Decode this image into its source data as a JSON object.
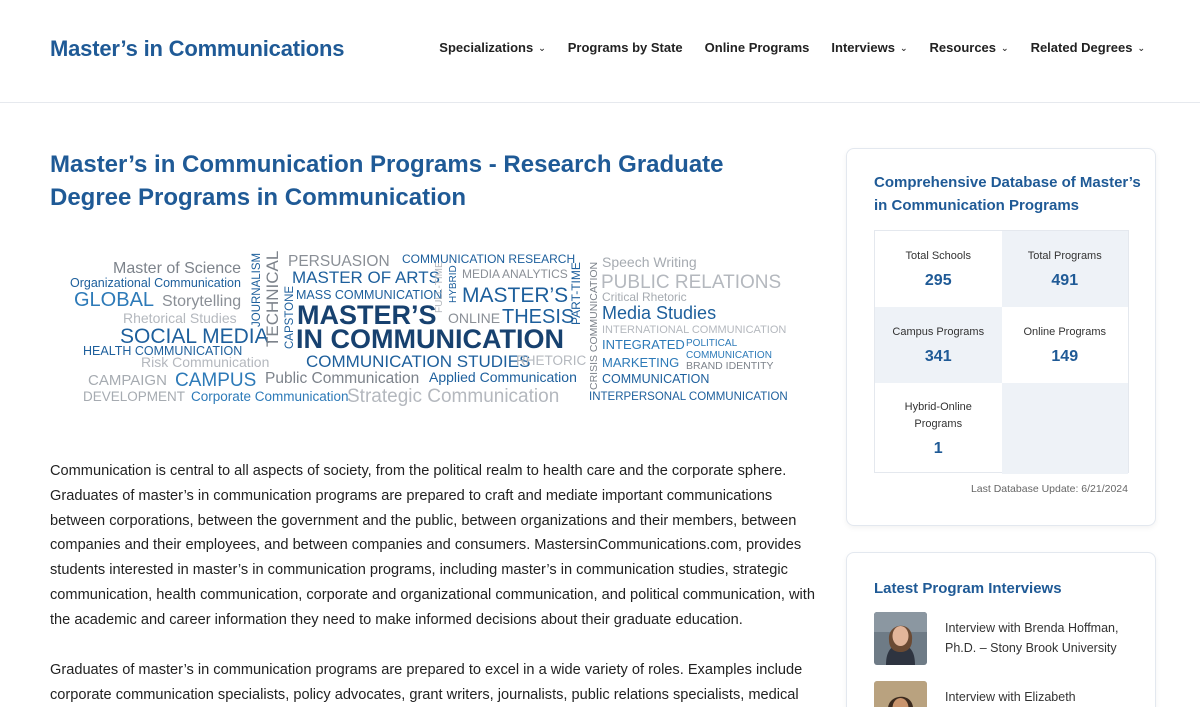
{
  "header": {
    "logo": "Master’s in Communications",
    "nav": [
      {
        "label": "Specializations",
        "has_dropdown": true
      },
      {
        "label": "Programs by State",
        "has_dropdown": false
      },
      {
        "label": "Online Programs",
        "has_dropdown": false
      },
      {
        "label": "Interviews",
        "has_dropdown": true
      },
      {
        "label": "Resources",
        "has_dropdown": true
      },
      {
        "label": "Related Degrees",
        "has_dropdown": true
      }
    ]
  },
  "main": {
    "title": "Master’s in Communication Programs - Research Graduate Degree Programs in Communication",
    "paragraphs": [
      "Communication is central to all aspects of society, from the political realm to health care and the corporate sphere. Graduates of master’s in communication programs are prepared to craft and mediate important communications between corporations, between the government and the public, between organizations and their members, between companies and their employees, and between companies and consumers. MastersinCommunications.com, provides students interested in master’s in communication programs, including master’s in communication studies, strategic communication, health communication, corporate and organizational communication, and political communication, with the academic and career information they need to make informed decisions about their graduate education.",
      "Graduates of master’s in communication programs are prepared to excel in a wide variety of roles. Examples include corporate communication specialists, policy advocates, grant writers, journalists, public relations specialists, medical and"
    ],
    "wordcloud": {
      "words": {
        "master_of_science": "Master of Science",
        "org_comm": "Organizational Communication",
        "global": "GLOBAL",
        "storytelling": "Storytelling",
        "rhetorical": "Rhetorical Studies",
        "social_media": "SOCIAL MEDIA",
        "health_comm": "HEALTH COMMUNICATION",
        "risk_comm": "Risk Communication",
        "campaign": "CAMPAIGN",
        "campus": "CAMPUS",
        "development": "DEVELOPMENT",
        "corporate_comm": "Corporate Communication",
        "journalism": "JOURNALISM",
        "technical": "TECHNICAL",
        "capstone": "CAPSTONE",
        "persuasion": "PERSUASION",
        "master_of_arts": "MASTER OF ARTS",
        "mass_comm": "MASS COMMUNICATION",
        "masters": "MASTER’S",
        "in_communication": "IN COMMUNICATION",
        "full_time": "FULL-TIME",
        "hybrid": "HYBRID",
        "online": "ONLINE",
        "comm_research": "COMMUNICATION RESEARCH",
        "media_analytics": "MEDIA ANALYTICS",
        "masters2": "MASTER’S",
        "thesis": "THESIS",
        "part_time": "PART-TIME",
        "comm_studies": "COMMUNICATION STUDIES",
        "rhetoric": "RHETORIC",
        "public_comm": "Public Communication",
        "applied_comm": "Applied Communication",
        "strategic_comm": "Strategic Communication",
        "crisis_comm": "CRISIS COMMUNICATION",
        "speech_writing": "Speech Writing",
        "public_relations": "PUBLIC RELATIONS",
        "critical_rhetoric": "Critical Rhetoric",
        "media_studies": "Media Studies",
        "intl_comm": "INTERNATIONAL COMMUNICATION",
        "integrated": "INTEGRATED",
        "marketing": "MARKETING",
        "communication": "COMMUNICATION",
        "political": "POLITICAL",
        "political2": "COMMUNICATION",
        "brand_identity": "BRAND IDENTITY",
        "interpersonal": "INTERPERSONAL COMMUNICATION"
      }
    }
  },
  "sidebar": {
    "database": {
      "title": "Comprehensive Database of Master’s in Communication Programs",
      "stats": [
        {
          "label": "Total Schools",
          "value": "295"
        },
        {
          "label": "Total Programs",
          "value": "491"
        },
        {
          "label": "Campus Programs",
          "value": "341"
        },
        {
          "label": "Online Programs",
          "value": "149"
        },
        {
          "label": "Hybrid-Online Programs",
          "value": "1"
        }
      ],
      "last_update": "Last Database Update: 6/21/2024"
    },
    "interviews": {
      "title": "Latest Program Interviews",
      "items": [
        {
          "text": "Interview with Brenda Hoffman, Ph.D. – Stony Brook University"
        },
        {
          "text": "Interview with Elizabeth Robertson Hornsby, Ph.D."
        }
      ]
    }
  },
  "colors": {
    "brand_blue": "#1f5a96",
    "cloud_blue": "#1d5f9c",
    "cloud_gray": "#8a8f96",
    "stat_shade": "#eef2f7"
  }
}
